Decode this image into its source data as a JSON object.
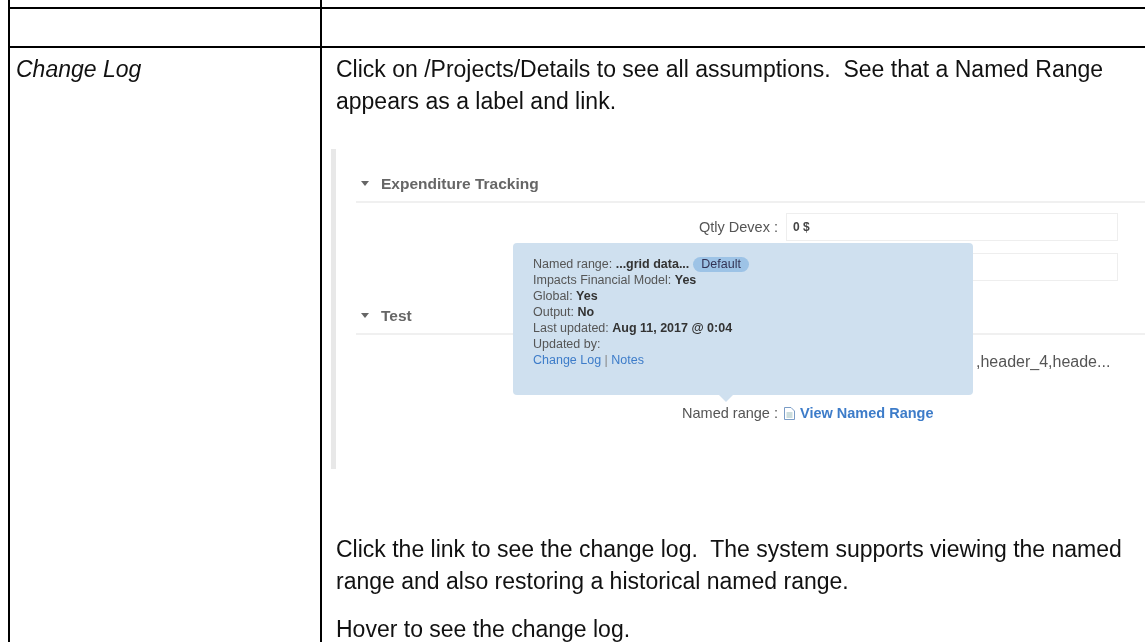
{
  "table": {
    "rows": [
      {
        "label": "Change Log",
        "before": [
          "Click on /Projects/Details to see all assumptions.  See that a Named Range appears as a label and link."
        ],
        "screenshot": {
          "sections": [
            {
              "title": "Expenditure Tracking",
              "expanded": true
            },
            {
              "title": "Test",
              "expanded": true
            }
          ],
          "field": {
            "label": "Qtly Devex :",
            "value": "0 $"
          },
          "tooltip": {
            "lines": [
              "Named range: **...grid data...**",
              "Impacts Financial Model: **Yes**",
              "Global: **Yes**",
              "Output: **No**",
              "Last updated: **Aug 11, 2017 @ 0:04**",
              "Updated by:"
            ],
            "badge": "Default",
            "links": [
              "Change Log",
              "Notes"
            ],
            "separator": "|"
          },
          "value_text": ",header_4,heade...",
          "named_range_label": "Named range :",
          "named_range_link": "View Named Range"
        },
        "after": [
          "Click the link to see the change log.  The system supports viewing the named range and also restoring a historical named range.",
          "Hover to see the change log."
        ]
      }
    ]
  }
}
